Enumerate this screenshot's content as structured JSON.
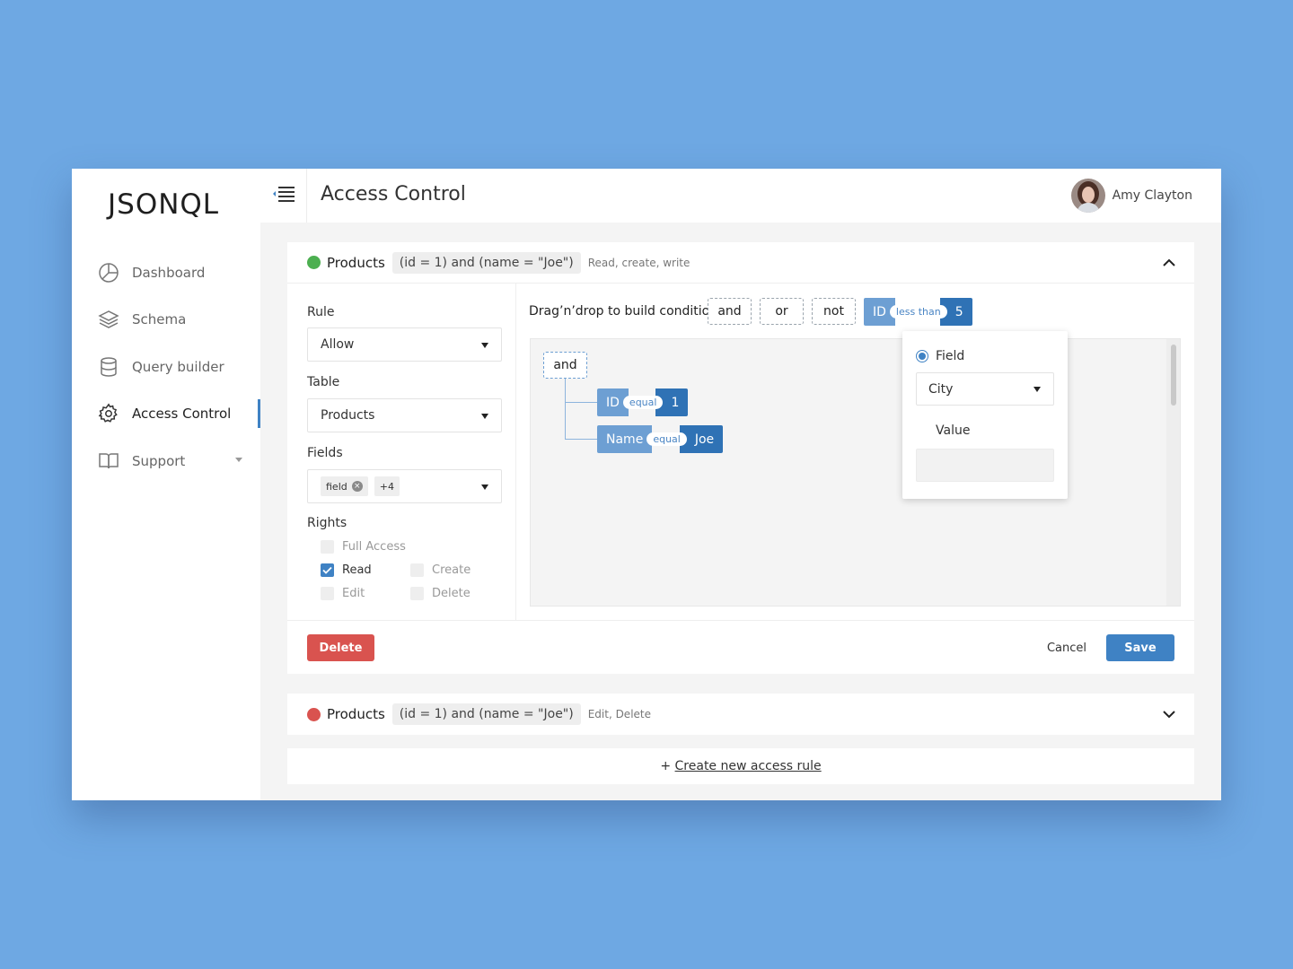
{
  "app": {
    "logo": "JSONQL"
  },
  "sidebar": {
    "items": [
      {
        "label": "Dashboard",
        "icon": "pie-chart-icon"
      },
      {
        "label": "Schema",
        "icon": "layers-icon"
      },
      {
        "label": "Query builder",
        "icon": "database-icon"
      },
      {
        "label": "Access Control",
        "icon": "gear-icon",
        "active": true
      },
      {
        "label": "Support",
        "icon": "book-icon"
      }
    ]
  },
  "header": {
    "title": "Access Control",
    "user_name": "Amy Clayton"
  },
  "rule1": {
    "status_color": "#4caf50",
    "table": "Products",
    "condition": "(id = 1) and (name = \"Joe\")",
    "rights": "Read, create, write",
    "form": {
      "rule_label": "Rule",
      "rule_value": "Allow",
      "table_label": "Table",
      "table_value": "Products",
      "fields_label": "Fields",
      "field_tag": "field",
      "more_tag": "+4",
      "rights_label": "Rights",
      "checkboxes": {
        "full_access": "Full Access",
        "read": "Read",
        "create": "Create",
        "edit": "Edit",
        "delete": "Delete"
      }
    },
    "builder": {
      "instruction": "Drag’n’drop to build condition",
      "ops": [
        "and",
        "or",
        "not"
      ],
      "palette_chip": {
        "field": "ID",
        "op": "less than",
        "value": "5"
      },
      "root": "and",
      "conditions": [
        {
          "field": "ID",
          "op": "equal",
          "value": "1"
        },
        {
          "field": "Name",
          "op": "equal",
          "value": "Joe"
        }
      ],
      "popover": {
        "radio_label": "Field",
        "field_value": "City",
        "value_label": "Value",
        "value_input": ""
      }
    },
    "buttons": {
      "delete": "Delete",
      "cancel": "Cancel",
      "save": "Save"
    }
  },
  "rule2": {
    "status_color": "#d9534f",
    "table": "Products",
    "condition": "(id = 1) and (name = \"Joe\")",
    "rights": "Edit, Delete"
  },
  "create": {
    "plus": "+",
    "link": "Create new access rule"
  },
  "colors": {
    "accent": "#3f82c4",
    "danger": "#d9534f",
    "success": "#4caf50",
    "background": "#6ea8e3"
  }
}
